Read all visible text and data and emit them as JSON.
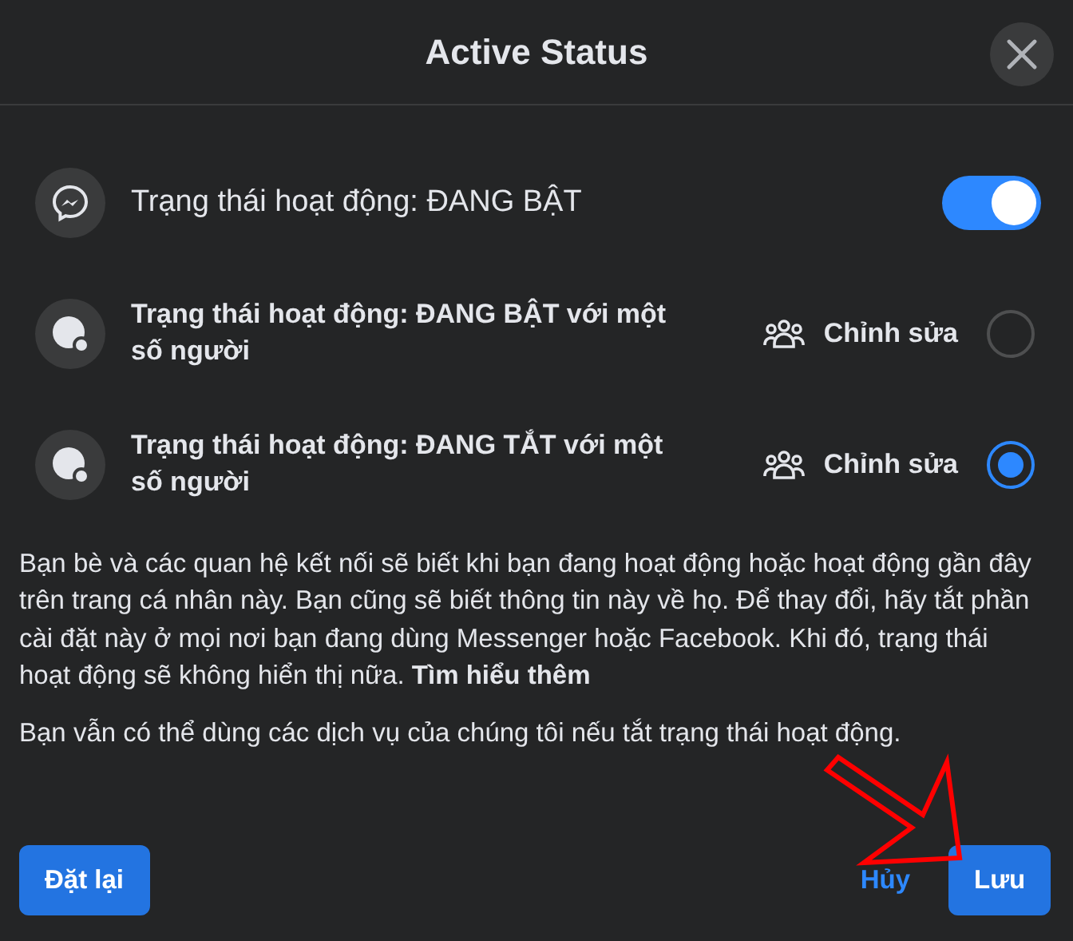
{
  "dialog": {
    "title": "Active Status"
  },
  "master": {
    "label": "Trạng thái hoạt động: ĐANG BẬT",
    "on": true
  },
  "options": [
    {
      "label": "Trạng thái hoạt động: ĐANG BẬT với một số người",
      "action": "Chỉnh sửa",
      "selected": false
    },
    {
      "label": "Trạng thái hoạt động: ĐANG TẮT với một số người",
      "action": "Chỉnh sửa",
      "selected": true
    }
  ],
  "description": "Bạn bè và các quan hệ kết nối sẽ biết khi bạn đang hoạt động hoặc hoạt động gần đây trên trang cá nhân này. Bạn cũng sẽ biết thông tin này về họ. Để thay đổi, hãy tắt phần cài đặt này ở mọi nơi bạn đang dùng Messenger hoặc Facebook. Khi đó, trạng thái hoạt động sẽ không hiển thị nữa. **Tìm hiểu thêm**",
  "note": "Bạn vẫn có thể dùng các dịch vụ của chúng tôi nếu tắt trạng thái hoạt động.",
  "buttons": [
    {
      "kind": "reset",
      "label": "Đặt lại"
    },
    {
      "kind": "cancel",
      "label": "Hủy"
    },
    {
      "kind": "save",
      "label": "Lưu"
    }
  ]
}
